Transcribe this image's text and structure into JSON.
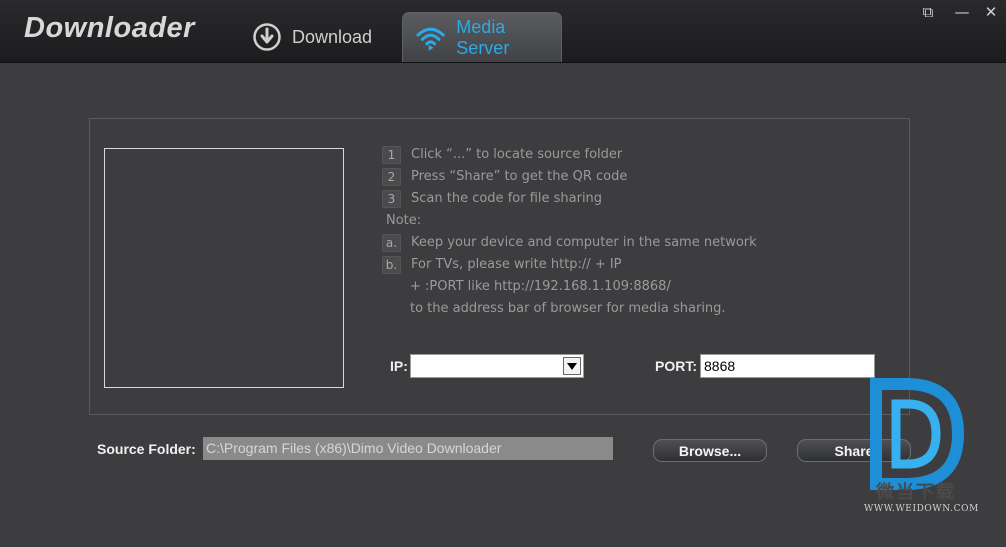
{
  "app": {
    "title": "Downloader"
  },
  "tabs": [
    {
      "label": "Download",
      "icon": "download-arrow-icon",
      "active": false
    },
    {
      "label": "Media Server",
      "icon": "wifi-icon",
      "active": true
    }
  ],
  "window_controls": {
    "restore": "⧉",
    "minimize": "—",
    "close": "✕"
  },
  "instructions": {
    "steps": [
      {
        "badge": "1",
        "text": "Click “...” to locate source folder"
      },
      {
        "badge": "2",
        "text": "Press “Share” to get the QR code"
      },
      {
        "badge": "3",
        "text": "Scan the code for file sharing"
      }
    ],
    "note_label": "Note:",
    "notes": [
      {
        "badge": "a.",
        "text": "Keep your device and computer in the same network"
      },
      {
        "badge": "b.",
        "text": "For TVs, please write http:// + IP"
      }
    ],
    "note_b_line2": "+ :PORT like http://192.168.1.109:8868/",
    "note_b_line3": "to the address bar of browser for media sharing."
  },
  "ip": {
    "label": "IP:",
    "value": ""
  },
  "port": {
    "label": "PORT:",
    "value": "8868"
  },
  "source": {
    "label": "Source Folder:",
    "value": "C:\\Program Files (x86)\\Dimo Video Downloader"
  },
  "buttons": {
    "browse": "Browse...",
    "share": "Share"
  },
  "watermark": {
    "text": "微当下载",
    "url": "WWW.WEIDOWN.COM"
  },
  "colors": {
    "accent": "#2ea9e8",
    "background": "#3d3d3f",
    "titlebar": "#1f1f21"
  }
}
